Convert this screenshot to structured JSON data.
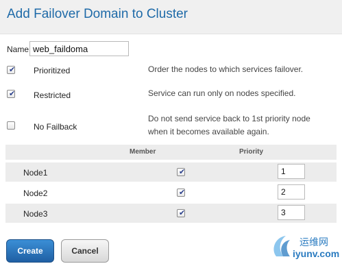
{
  "dialog": {
    "title": "Add Failover Domain to Cluster"
  },
  "name_field": {
    "label": "Name",
    "value": "web_faildoma"
  },
  "options": [
    {
      "label": "Prioritized",
      "checked": true,
      "description": "Order the nodes to which services failover."
    },
    {
      "label": "Restricted",
      "checked": true,
      "description": "Service can run only on nodes specified."
    },
    {
      "label": "No Failback",
      "checked": false,
      "description_line1": "Do not send service back to 1st priority node",
      "description_line2": "when it becomes available again."
    }
  ],
  "table": {
    "headers": {
      "member": "Member",
      "priority": "Priority"
    },
    "rows": [
      {
        "node": "Node1",
        "member": true,
        "priority": "1"
      },
      {
        "node": "Node2",
        "member": true,
        "priority": "2"
      },
      {
        "node": "Node3",
        "member": true,
        "priority": "3"
      }
    ]
  },
  "buttons": {
    "create": "Create",
    "cancel": "Cancel"
  },
  "watermark": {
    "cn": "运维网",
    "en": "iyunv.com"
  },
  "colors": {
    "title": "#1e6aa8",
    "primary_button": "#2a76bd",
    "row_alt": "#ececec"
  }
}
